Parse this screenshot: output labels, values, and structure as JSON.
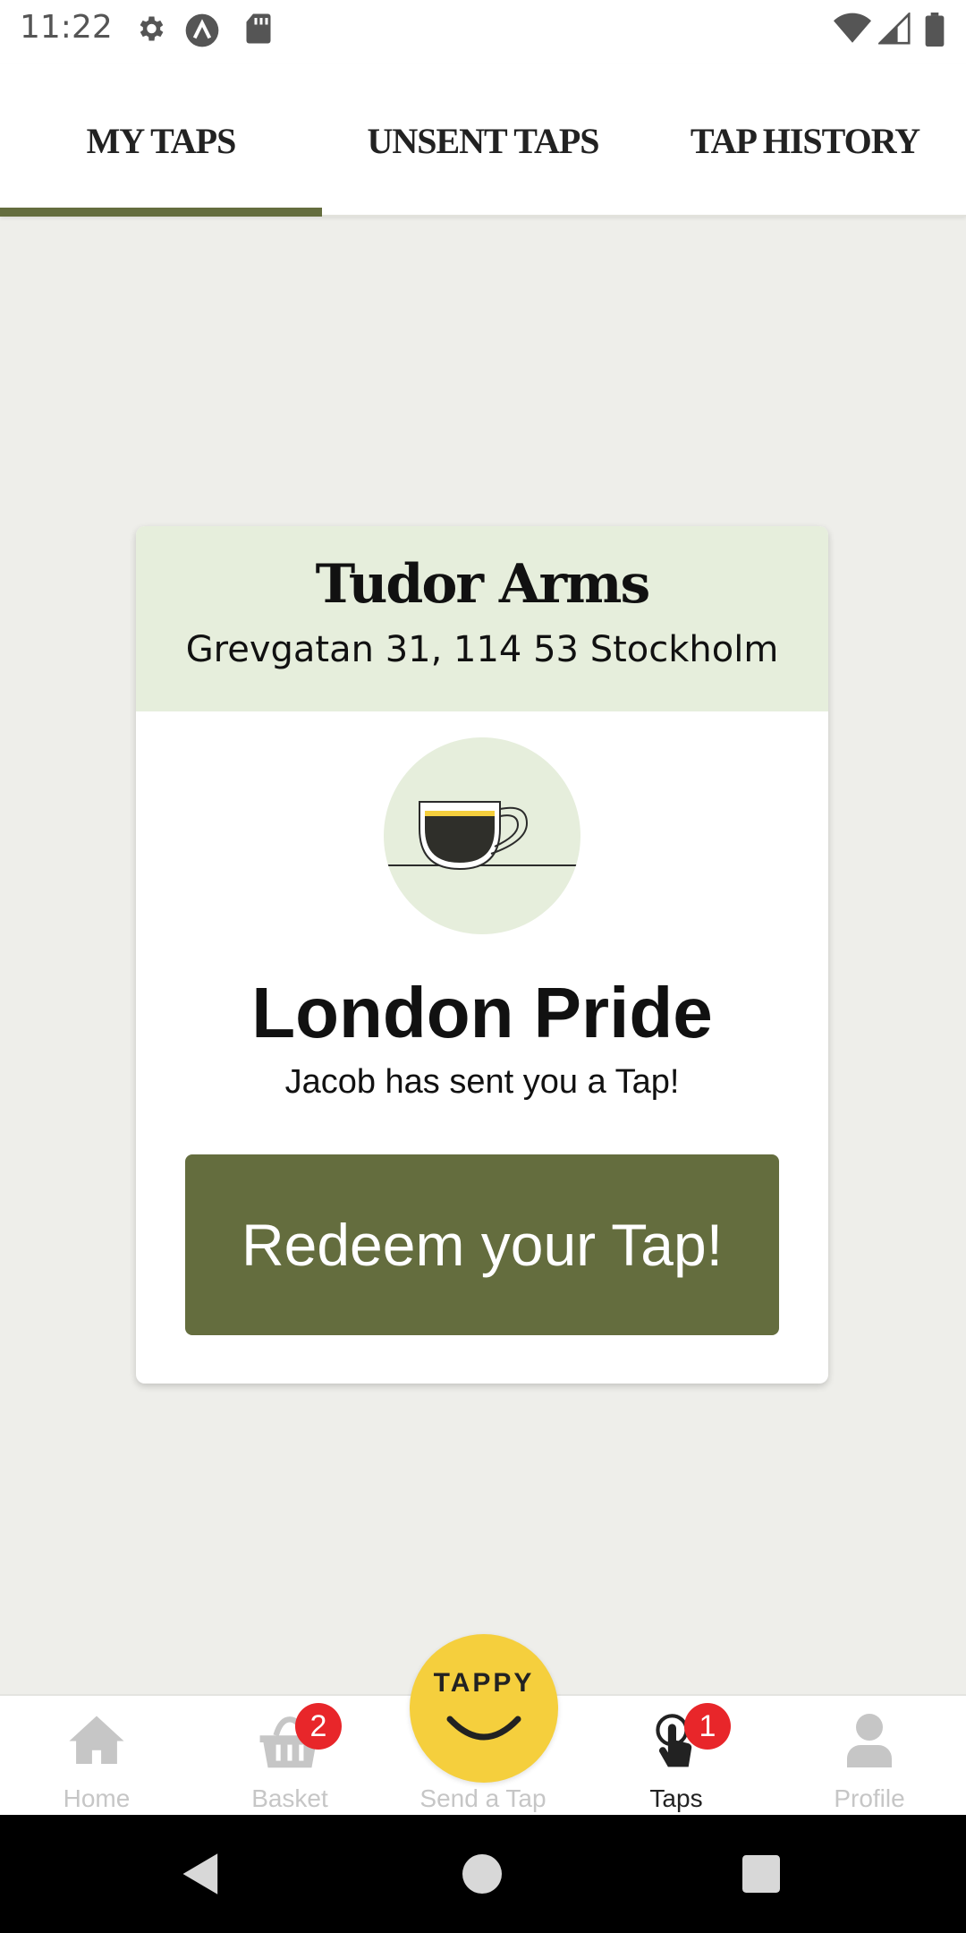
{
  "status_bar": {
    "time": "11:22",
    "icons": [
      "settings-icon",
      "app-a-icon",
      "sd-card-icon",
      "wifi-icon",
      "signal-icon",
      "battery-icon"
    ]
  },
  "tabs": [
    {
      "label": "MY TAPS",
      "active": true
    },
    {
      "label": "UNSENT TAPS",
      "active": false
    },
    {
      "label": "TAP HISTORY",
      "active": false
    }
  ],
  "card": {
    "venue_name": "Tudor Arms",
    "venue_address": "Grevgatan 31, 114 53 Stockholm",
    "drink_icon": "coffee-cup-icon",
    "drink_name": "London Pride",
    "message": "Jacob has sent you a Tap!",
    "redeem_label": "Redeem your Tap!"
  },
  "bottom_nav": {
    "items": [
      {
        "label": "Home",
        "icon": "home-icon",
        "active": false
      },
      {
        "label": "Basket",
        "icon": "basket-icon",
        "badge": "2",
        "active": false
      },
      {
        "label": "Send a Tap",
        "icon": "tappy-icon",
        "active": false
      },
      {
        "label": "Taps",
        "icon": "tap-hand-icon",
        "badge": "1",
        "active": true
      },
      {
        "label": "Profile",
        "icon": "profile-icon",
        "active": false
      }
    ],
    "fab_label": "TAPPY"
  },
  "colors": {
    "accent": "#646d3e",
    "card_header_bg": "#e6eedc",
    "fab": "#f5cf3d",
    "badge": "#e8262a",
    "background": "#eeeeea"
  }
}
